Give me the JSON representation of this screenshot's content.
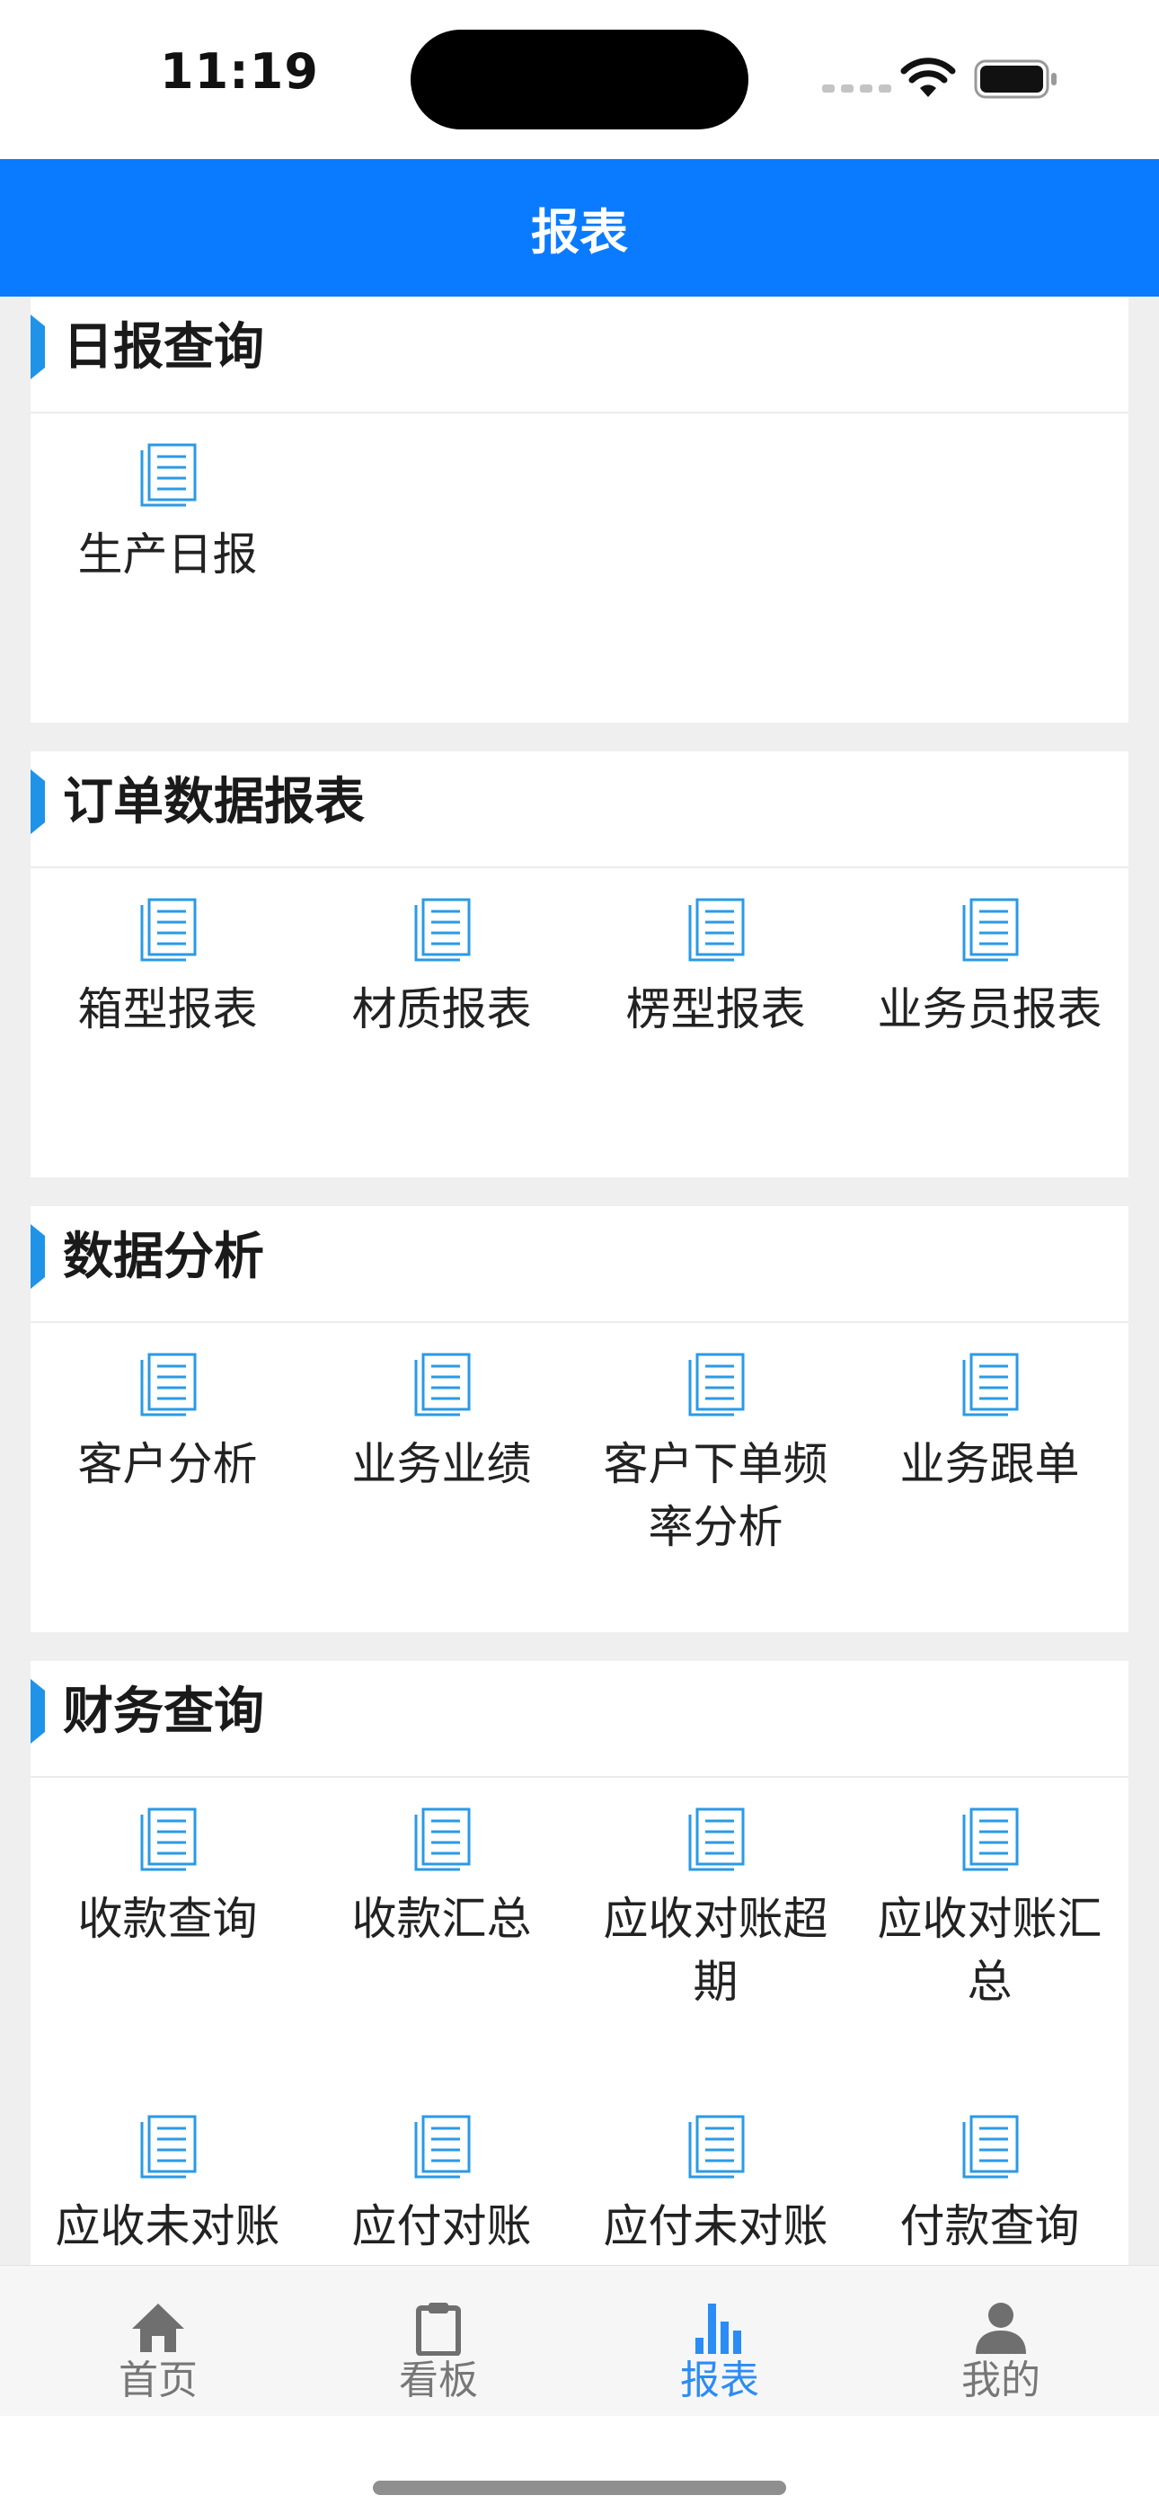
{
  "status_bar": {
    "time": "11:19"
  },
  "nav": {
    "title": "报表"
  },
  "sections": [
    {
      "title": "日报查询",
      "items": [
        {
          "label": "生产日报"
        }
      ]
    },
    {
      "title": "订单数据报表",
      "items": [
        {
          "label": "箱型报表"
        },
        {
          "label": "材质报表"
        },
        {
          "label": "楞型报表"
        },
        {
          "label": "业务员报表"
        }
      ]
    },
    {
      "title": "数据分析",
      "items": [
        {
          "label": "客户分析"
        },
        {
          "label": "业务业绩"
        },
        {
          "label": "客户下单频率分析"
        },
        {
          "label": "业务跟单"
        }
      ]
    },
    {
      "title": "财务查询",
      "items": [
        {
          "label": "收款查询"
        },
        {
          "label": "收款汇总"
        },
        {
          "label": "应收对账超期"
        },
        {
          "label": "应收对账汇总"
        },
        {
          "label": "应收未对账"
        },
        {
          "label": "应付对账"
        },
        {
          "label": "应付未对账"
        },
        {
          "label": "付款查询"
        }
      ]
    }
  ],
  "tab_bar": {
    "tabs": [
      {
        "label": "首页",
        "icon": "home-icon"
      },
      {
        "label": "看板",
        "icon": "clipboard-icon"
      },
      {
        "label": "报表",
        "icon": "bar-chart-icon",
        "active": true
      },
      {
        "label": "我的",
        "icon": "user-icon"
      }
    ]
  },
  "colors": {
    "nav": "#0a7bff",
    "accent": "#1f93e8",
    "active_tab": "#2b8cf5"
  }
}
